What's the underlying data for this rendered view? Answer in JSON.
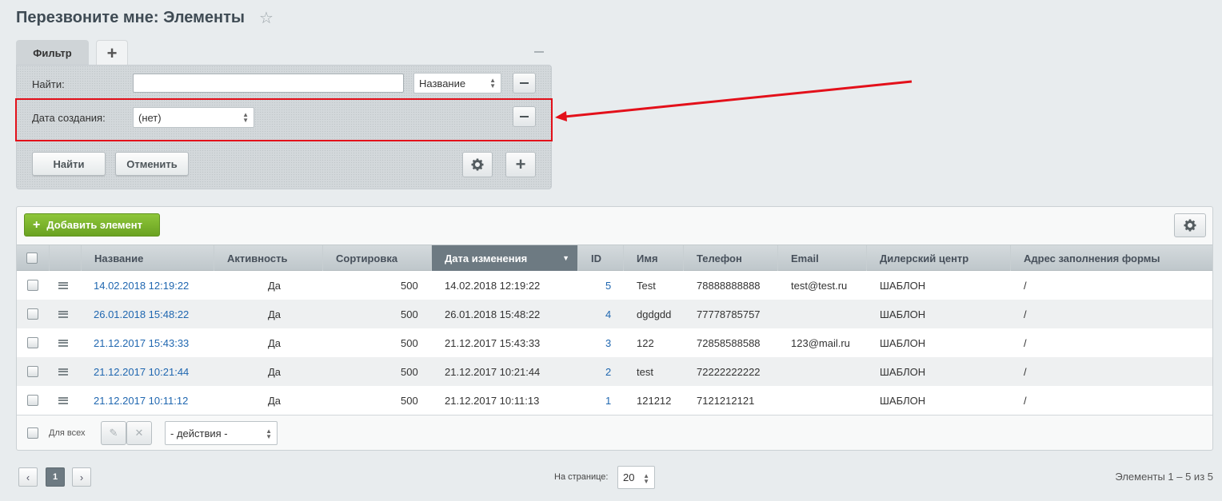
{
  "page": {
    "title": "Перезвоните мне: Элементы"
  },
  "filter": {
    "tab_label": "Фильтр",
    "find_label": "Найти:",
    "find_value": "",
    "find_field": "Название",
    "date_label": "Дата создания:",
    "date_value": "(нет)",
    "find_button": "Найти",
    "cancel_button": "Отменить"
  },
  "annotation": {
    "highlight_color": "#e3101a"
  },
  "grid": {
    "add_button": "Добавить элемент",
    "columns": [
      "Название",
      "Активность",
      "Сортировка",
      "Дата изменения",
      "ID",
      "Имя",
      "Телефон",
      "Email",
      "Дилерский центр",
      "Адрес заполнения формы"
    ],
    "sorted_column": "Дата изменения",
    "rows": [
      {
        "name": "14.02.2018 12:19:22",
        "active": "Да",
        "sort": "500",
        "modified": "14.02.2018 12:19:22",
        "id": "5",
        "person": "Test",
        "phone": "78888888888",
        "email": "test@test.ru",
        "dealer": "ШАБЛОН",
        "address": "/"
      },
      {
        "name": "26.01.2018 15:48:22",
        "active": "Да",
        "sort": "500",
        "modified": "26.01.2018 15:48:22",
        "id": "4",
        "person": "dgdgdd",
        "phone": "77778785757",
        "email": "",
        "dealer": "ШАБЛОН",
        "address": "/"
      },
      {
        "name": "21.12.2017 15:43:33",
        "active": "Да",
        "sort": "500",
        "modified": "21.12.2017 15:43:33",
        "id": "3",
        "person": "122",
        "phone": "72858588588",
        "email": "123@mail.ru",
        "dealer": "ШАБЛОН",
        "address": "/"
      },
      {
        "name": "21.12.2017 10:21:44",
        "active": "Да",
        "sort": "500",
        "modified": "21.12.2017 10:21:44",
        "id": "2",
        "person": "test",
        "phone": "72222222222",
        "email": "",
        "dealer": "ШАБЛОН",
        "address": "/"
      },
      {
        "name": "21.12.2017 10:11:12",
        "active": "Да",
        "sort": "500",
        "modified": "21.12.2017 10:11:13",
        "id": "1",
        "person": "121212",
        "phone": "7121212121",
        "email": "",
        "dealer": "ШАБЛОН",
        "address": "/"
      }
    ],
    "for_all_label": "Для всех",
    "actions_select": "- действия -"
  },
  "pagination": {
    "current_page": "1",
    "per_page_label": "На странице:",
    "per_page_value": "20",
    "summary": "Элементы 1 – 5 из 5"
  },
  "colors": {
    "accent_green": "#7cb52d",
    "link": "#2067b0",
    "sorted_header": "#6d7a82"
  }
}
